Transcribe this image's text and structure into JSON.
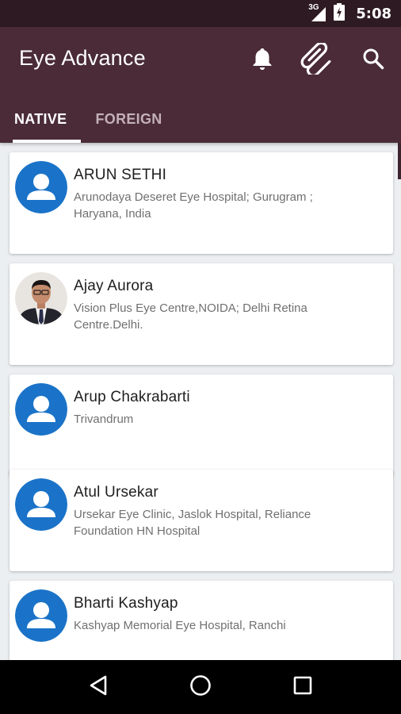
{
  "status_bar": {
    "network": "3G",
    "time": "5:08"
  },
  "app_bar": {
    "title": "Eye Advance",
    "icons": [
      "bell-icon",
      "attachment-icon",
      "search-icon"
    ]
  },
  "tabs": [
    {
      "label": "NATIVE",
      "active": true
    },
    {
      "label": "FOREIGN",
      "active": false
    }
  ],
  "doctors": [
    {
      "name": "ARUN SETHI",
      "address": "Arunodaya Deseret Eye Hospital; Gurugram ; Haryana, India",
      "avatar": "placeholder"
    },
    {
      "name": "Ajay Aurora",
      "address": "Vision Plus Eye Centre,NOIDA; Delhi Retina Centre.Delhi.",
      "avatar": "photo"
    },
    {
      "name": "Arup Chakrabarti",
      "address": "Trivandrum",
      "avatar": "placeholder"
    },
    {
      "name": "Atul Ursekar",
      "address": "Ursekar Eye Clinic, Jaslok Hospital, Reliance Foundation HN Hospital",
      "avatar": "placeholder"
    },
    {
      "name": "Bharti Kashyap",
      "address": "Kashyap Memorial Eye Hospital, Ranchi",
      "avatar": "placeholder"
    }
  ],
  "nav_bar": {
    "buttons": [
      "back-icon",
      "home-icon",
      "recents-icon"
    ]
  },
  "colors": {
    "status_bar": "#2e1a22",
    "app_bar": "#4a2b37",
    "avatar_blue": "#1a73c8",
    "background": "#eceff1"
  }
}
